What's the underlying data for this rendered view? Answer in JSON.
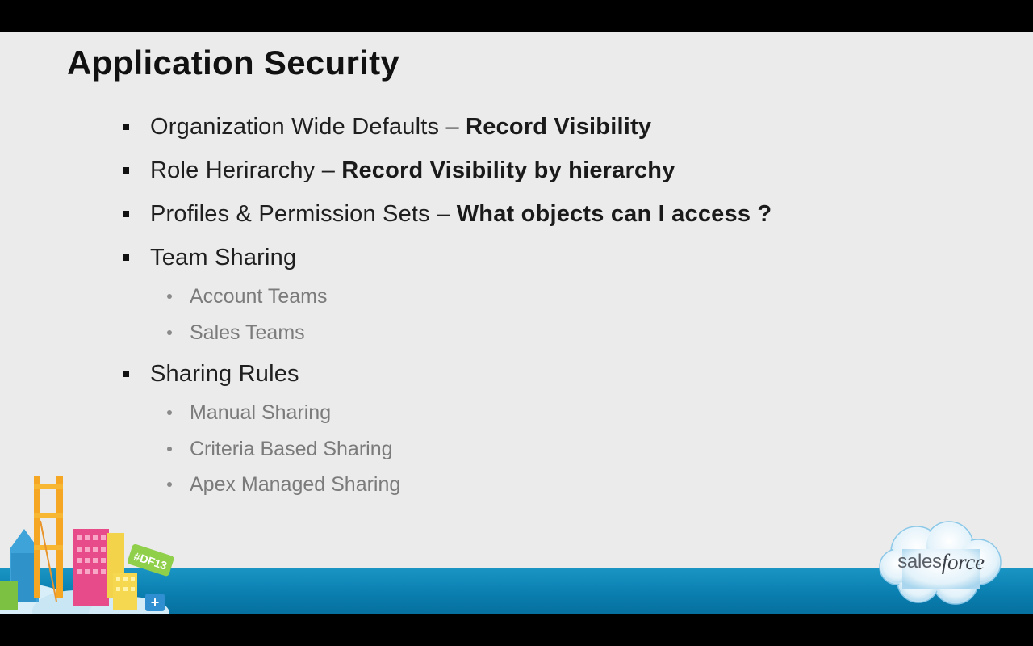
{
  "slide": {
    "title": "Application Security",
    "bullets": [
      {
        "text": "Organization  Wide Defaults – ",
        "bold": "Record Visibility"
      },
      {
        "text": "Role Herirarchy – ",
        "bold": "Record Visibility by hierarchy"
      },
      {
        "text": "Profiles & Permission Sets – ",
        "bold": "What objects can I access ?"
      },
      {
        "text": "Team Sharing",
        "bold": "",
        "sub": [
          "Account Teams",
          "Sales Teams"
        ]
      },
      {
        "text": "Sharing Rules",
        "bold": "",
        "sub": [
          "Manual Sharing",
          "Criteria Based Sharing",
          "Apex Managed Sharing"
        ]
      }
    ]
  },
  "branding": {
    "logo_text_regular": "sales",
    "logo_text_italic": "force",
    "badge_text": "#DF13",
    "logo_icon": "salesforce-cloud-icon",
    "city_icon": "dreamforce-city-skyline-icon"
  },
  "colors": {
    "slide_background": "#ebebeb",
    "footer_band": "#0a7fb0",
    "title": "#111111",
    "subitem_text": "#7b7b7b"
  }
}
